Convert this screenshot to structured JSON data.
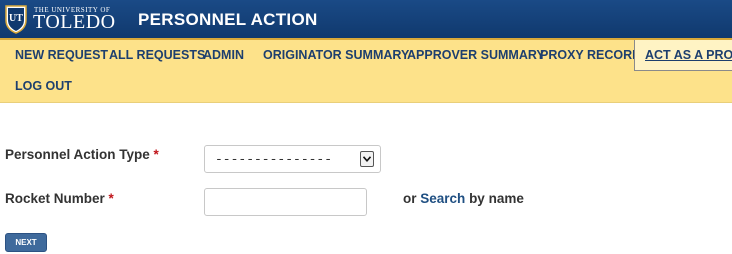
{
  "header": {
    "university_small": "THE UNIVERSITY OF",
    "university_name": "TOLEDO",
    "logo_monogram": "UT",
    "app_title": "PERSONNEL ACTION",
    "colors": {
      "bar": "#10396e",
      "accent": "#d9a93a"
    }
  },
  "nav": {
    "items": [
      {
        "label": "NEW REQUEST"
      },
      {
        "label": "ALL REQUESTS"
      },
      {
        "label": "ADMIN"
      },
      {
        "label": "ORIGINATOR SUMMARY"
      },
      {
        "label": "APPROVER SUMMARY"
      },
      {
        "label": "PROXY RECORDS"
      },
      {
        "label": "ACT AS A PROXY",
        "active": true
      },
      {
        "label": "LOG OUT"
      }
    ],
    "background": "#fde28a"
  },
  "form": {
    "type_label": "Personnel Action Type",
    "type_required": "*",
    "type_value": "---------------",
    "rocket_label": "Rocket Number",
    "rocket_required": "*",
    "rocket_value": "",
    "or_text": "or",
    "search_link": "Search",
    "by_name": "by name",
    "next_label": "NEXT"
  }
}
